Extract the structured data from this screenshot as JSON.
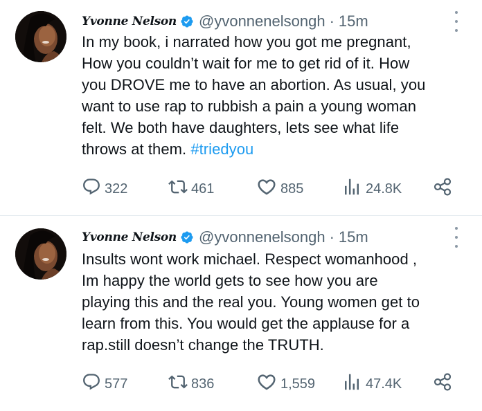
{
  "tweets": [
    {
      "display_name": "Yvonne Nelson",
      "handle": "@yvonnenelsongh",
      "separator": "·",
      "time": "15m",
      "body_lines": [
        "In my book, i narrated how you got me pregnant,",
        "How you couldn’t wait for me to get rid of it. How",
        "you DROVE me to have an abortion. As usual, you",
        "want to use rap to rubbish a pain a young woman",
        "felt. We both have daughters, lets see what life",
        "throws at them. "
      ],
      "hashtag": "#triedyou",
      "replies": "322",
      "retweets": "461",
      "likes": "885",
      "views": "24.8K"
    },
    {
      "display_name": "Yvonne Nelson",
      "handle": "@yvonnenelsongh",
      "separator": "·",
      "time": "15m",
      "body_lines": [
        "Insults wont work michael. Respect womanhood ,",
        "Im happy the world gets to see how you are",
        "playing this and the real you. Young women get to",
        "learn from this. You would get the applause for a",
        "rap.still doesn’t change the TRUTH."
      ],
      "replies": "577",
      "retweets": "836",
      "likes": "1,559",
      "views": "47.4K"
    }
  ],
  "icons": [
    "verified-badge-icon",
    "more-options-icon",
    "reply-icon",
    "retweet-icon",
    "like-icon",
    "views-icon",
    "share-icon"
  ],
  "colors": {
    "text": "#0f1419",
    "secondary": "#536471",
    "accent": "#1d9bf0",
    "divider": "#e6ecf0"
  }
}
